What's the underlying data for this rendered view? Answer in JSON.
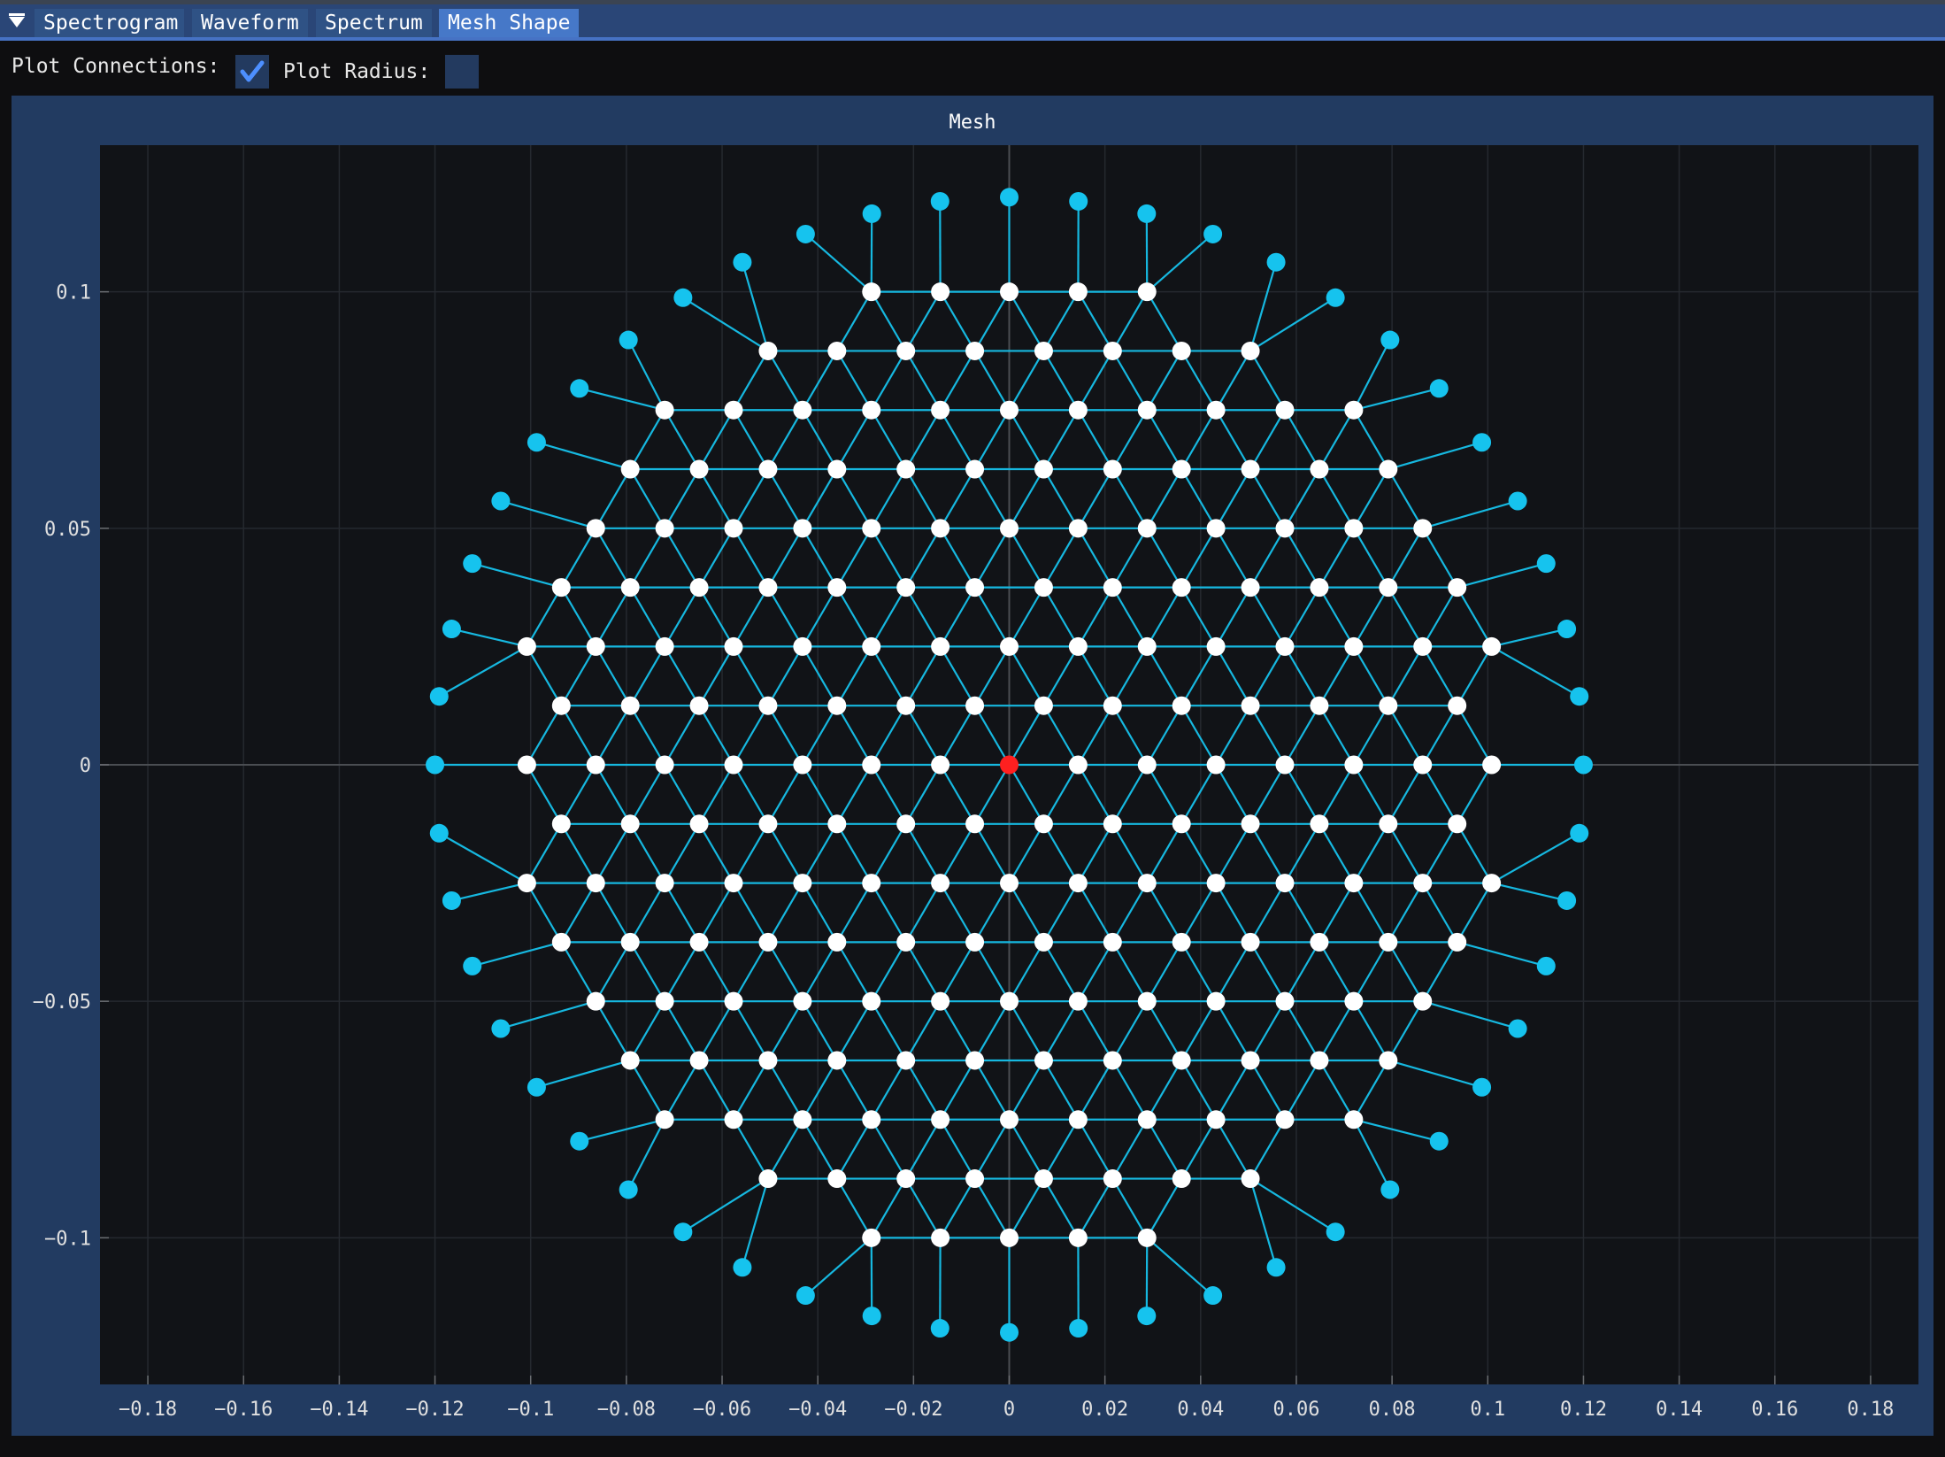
{
  "tabs": [
    {
      "label": "Spectrogram",
      "active": false
    },
    {
      "label": "Waveform",
      "active": false
    },
    {
      "label": "Spectrum",
      "active": false
    },
    {
      "label": "Mesh Shape",
      "active": true
    }
  ],
  "toolbar": {
    "plot_connections_label": "Plot Connections:",
    "plot_connections_checked": true,
    "plot_radius_label": "Plot Radius:",
    "plot_radius_checked": false
  },
  "colors": {
    "accent": "#4678c8",
    "interior_node": "#ffffff",
    "boundary_node": "#16c3ee",
    "center_node": "#ff2020",
    "connection": "#16b8e0",
    "plot_bg": "#111317",
    "frame_bg": "#223b61"
  },
  "chart_data": {
    "type": "scatter",
    "title": "Mesh",
    "xlabel": "",
    "ylabel": "",
    "xlim": [
      -0.19,
      0.19
    ],
    "ylim": [
      -0.131,
      0.131
    ],
    "grid": true,
    "x_ticks": [
      "-0.18",
      "-0.16",
      "-0.14",
      "-0.12",
      "-0.1",
      "-0.08",
      "-0.06",
      "-0.04",
      "-0.02",
      "0",
      "0.02",
      "0.04",
      "0.06",
      "0.08",
      "0.1",
      "0.12",
      "0.14",
      "0.16",
      "0.18"
    ],
    "y_ticks": [
      "0.1",
      "0.05",
      "0",
      "-0.05",
      "-0.1"
    ],
    "mesh": {
      "spacing": 0.0144,
      "row_spacing": 0.0125,
      "interior_rows": [
        {
          "row": 8,
          "count": 5
        },
        {
          "row": 7,
          "count": 8
        },
        {
          "row": 6,
          "count": 11
        },
        {
          "row": 5,
          "count": 12
        },
        {
          "row": 4,
          "count": 13
        },
        {
          "row": 3,
          "count": 14
        },
        {
          "row": 2,
          "count": 15
        },
        {
          "row": 1,
          "count": 14
        },
        {
          "row": 0,
          "count": 15
        },
        {
          "row": -1,
          "count": 14
        },
        {
          "row": -2,
          "count": 15
        },
        {
          "row": -3,
          "count": 14
        },
        {
          "row": -4,
          "count": 13
        },
        {
          "row": -5,
          "count": 12
        },
        {
          "row": -6,
          "count": 11
        },
        {
          "row": -7,
          "count": 8
        },
        {
          "row": -8,
          "count": 5
        }
      ],
      "boundary_radius": 0.12,
      "boundary_count": 52,
      "center_point": [
        0,
        0
      ]
    },
    "series": [
      {
        "name": "interior",
        "marker": "white"
      },
      {
        "name": "boundary",
        "marker": "cyan"
      },
      {
        "name": "center",
        "marker": "red"
      }
    ]
  }
}
